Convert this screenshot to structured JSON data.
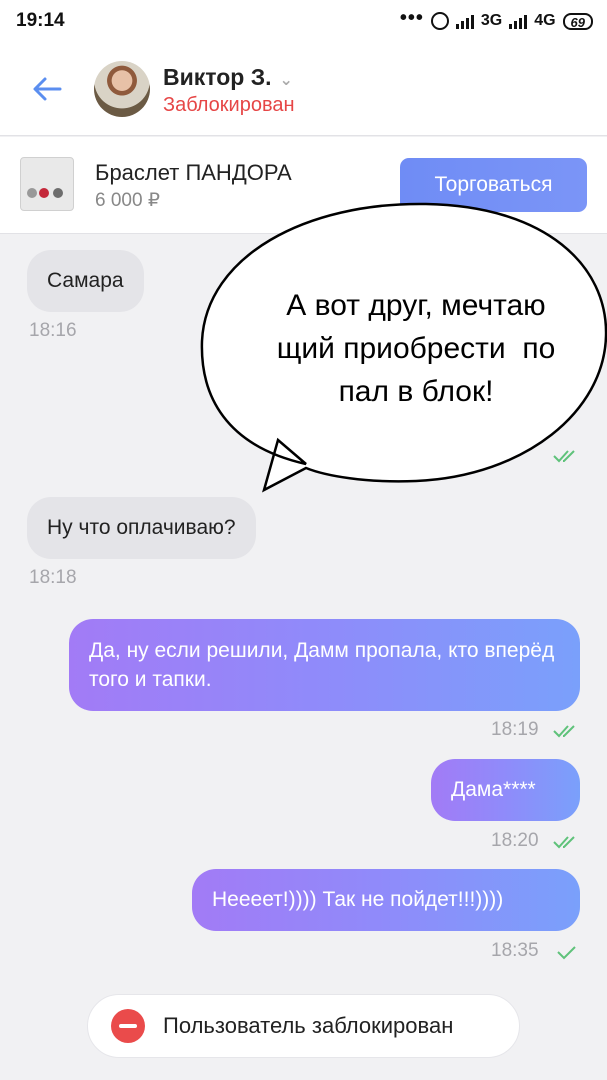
{
  "status_bar": {
    "time": "19:14",
    "network_1": "3G",
    "network_2": "4G",
    "battery": "69"
  },
  "header": {
    "contact_name": "Виктор З.",
    "contact_status": "Заблокирован",
    "icons": {
      "back": "back-arrow-icon",
      "chevron": "chevron-down-icon"
    }
  },
  "product": {
    "title": "Браслет ПАНДОРА",
    "price": "6 000 ₽",
    "bargain_label": "Торговаться"
  },
  "messages": [
    {
      "direction": "in",
      "text": "Самара",
      "time": "18:16"
    },
    {
      "direction": "in",
      "text": "Ну что оплачиваю?",
      "time": "18:18"
    },
    {
      "direction": "out",
      "text": "Да, ну если решили, Дамм пропала, кто вперёд того и тапки.",
      "time": "18:19",
      "status": "read"
    },
    {
      "direction": "out",
      "text": "Дама****",
      "time": "18:20",
      "status": "read"
    },
    {
      "direction": "out",
      "text": "Неееет!)))) Так не пойдет!!!))))",
      "time": "18:35",
      "status": "delivered"
    }
  ],
  "overlay_balloon": {
    "lines": [
      "А вот друг, мечтаю",
      "щий приобрести  по",
      "пал в блок!"
    ]
  },
  "footer": {
    "blocked_notice": "Пользователь заблокирован"
  },
  "colors": {
    "accent": "#6f8cf5",
    "blocked_red": "#e64646",
    "out_bubble_start": "#a27bf6",
    "out_bubble_end": "#7aa0fb",
    "in_bubble": "#e4e4e8",
    "check_green": "#5fc27a"
  }
}
